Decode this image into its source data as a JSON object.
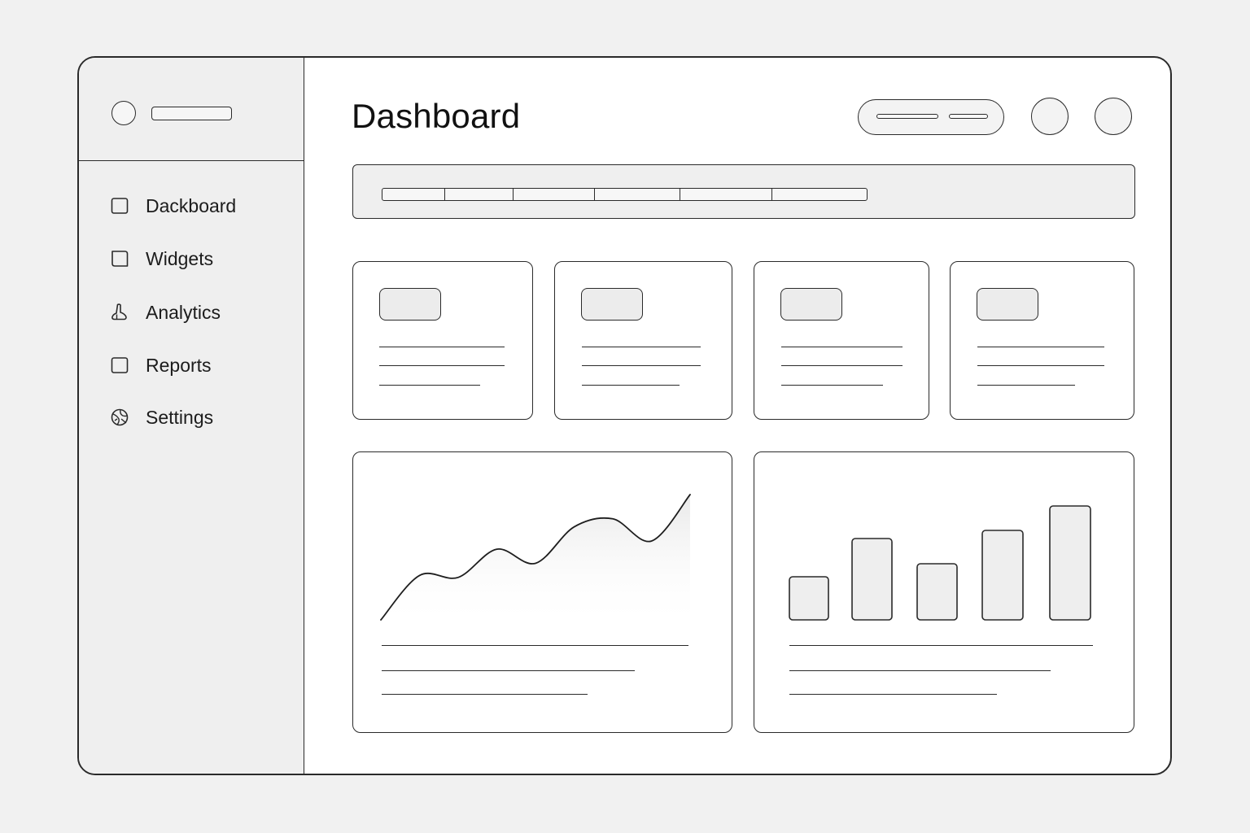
{
  "page": {
    "title": "Dashboard"
  },
  "sidebar": {
    "items": [
      {
        "label": "Dackboard",
        "icon": "square-icon"
      },
      {
        "label": "Widgets",
        "icon": "page-icon"
      },
      {
        "label": "Analytics",
        "icon": "flask-icon"
      },
      {
        "label": "Reports",
        "icon": "square-icon"
      },
      {
        "label": "Settings",
        "icon": "globe-icon"
      }
    ]
  },
  "header": {
    "title": "Dashboard"
  },
  "line_chart": {
    "type": "line",
    "values": [
      0,
      22,
      21,
      35,
      28,
      46,
      50,
      39,
      62
    ]
  },
  "bar_chart": {
    "type": "bar",
    "values": [
      53,
      100,
      69,
      110,
      140
    ]
  },
  "colors": {
    "stroke": "#2a2a2a",
    "sidebar_bg": "#efefef",
    "canvas_bg": "#f1f1f1"
  }
}
